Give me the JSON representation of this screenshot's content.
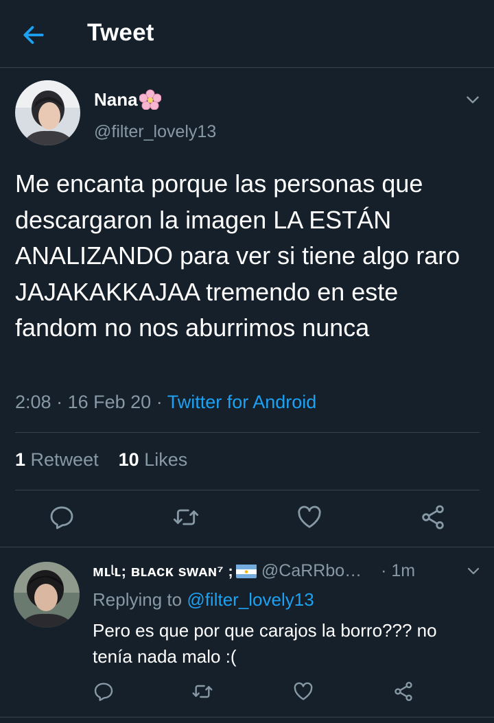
{
  "header": {
    "title": "Tweet",
    "back_icon": "arrow-left-icon"
  },
  "tweet": {
    "author_name": "Nana",
    "author_emoji": "cherry-blossom",
    "handle": "@filter_lovely13",
    "text": "Me encanta porque las personas que descargaron la imagen LA ESTÁN ANALIZANDO para ver si tiene algo raro JAJAKAKKAJAA tremendo en este fandom no nos aburrimos nunca",
    "time": "2:08",
    "date": "16 Feb 20",
    "source": "Twitter for Android",
    "retweet_count": "1",
    "retweet_label": "Retweet",
    "like_count": "10",
    "like_label": "Likes"
  },
  "reply": {
    "name": "ᴍʟᶩʟ; ʙʟᴀᴄᴋ sᴡᴀɴ⁷ ;",
    "flag": "argentina",
    "handle": "@CaRRbo…",
    "age": "· 1m",
    "replying_prefix": "Replying to",
    "replying_handle": "@filter_lovely13",
    "text": "Pero es que por que carajos la borro??? no tenía nada malo :("
  },
  "colors": {
    "background": "#15202b",
    "accent": "#1da1f2",
    "muted": "#8899a6",
    "divider": "#38444d"
  }
}
